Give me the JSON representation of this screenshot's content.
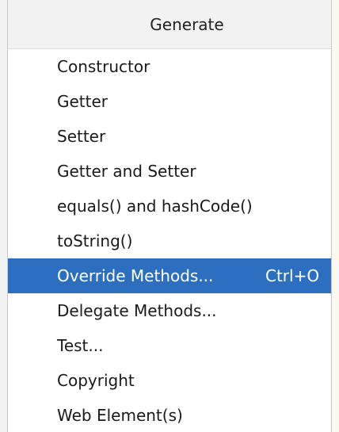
{
  "menu": {
    "title": "Generate",
    "items": [
      {
        "label": "Constructor",
        "shortcut": ""
      },
      {
        "label": "Getter",
        "shortcut": ""
      },
      {
        "label": "Setter",
        "shortcut": ""
      },
      {
        "label": "Getter and Setter",
        "shortcut": ""
      },
      {
        "label": "equals() and hashCode()",
        "shortcut": ""
      },
      {
        "label": "toString()",
        "shortcut": ""
      },
      {
        "label": "Override Methods...",
        "shortcut": "Ctrl+O"
      },
      {
        "label": "Delegate Methods...",
        "shortcut": ""
      },
      {
        "label": "Test...",
        "shortcut": ""
      },
      {
        "label": "Copyright",
        "shortcut": ""
      },
      {
        "label": "Web Element(s)",
        "shortcut": ""
      }
    ],
    "selected_index": 6
  },
  "colors": {
    "selection": "#2c6fc1",
    "header_background": "#f2f2f2",
    "text": "#1a1a1a"
  }
}
